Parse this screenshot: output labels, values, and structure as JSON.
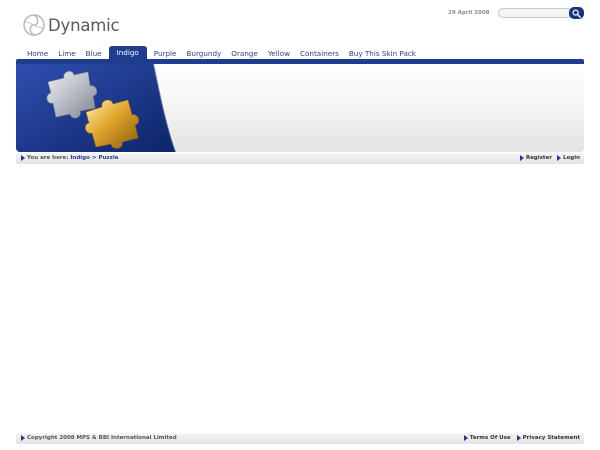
{
  "header": {
    "logo_text": "Dynamic",
    "date": "29 April 2008",
    "search": {
      "value": "",
      "placeholder": ""
    }
  },
  "nav": {
    "items": [
      {
        "label": "Home"
      },
      {
        "label": "Lime"
      },
      {
        "label": "Blue"
      },
      {
        "label": "Indigo",
        "active": true
      },
      {
        "label": "Purple"
      },
      {
        "label": "Burgundy"
      },
      {
        "label": "Orange"
      },
      {
        "label": "Yellow"
      },
      {
        "label": "Containers"
      },
      {
        "label": "Buy This Skin Pack"
      }
    ]
  },
  "breadcrumb": {
    "prefix": "You are here:",
    "items": [
      "Indigo",
      "Puzzle"
    ],
    "separator": ">"
  },
  "user_links": {
    "register": "Register",
    "login": "Login"
  },
  "footer": {
    "copyright": "Copyright 2008 MPS & BBI International Limited",
    "terms": "Terms Of Use",
    "privacy": "Privacy Statement"
  },
  "colors": {
    "accent": "#1f3c90",
    "nav_text": "#2c3f8e",
    "puzzle_gold": "#e0a62c",
    "puzzle_silver": "#b8bcc4"
  },
  "icons": [
    "swirl-logo-icon",
    "search-icon",
    "arrow-icon",
    "puzzle-image"
  ]
}
